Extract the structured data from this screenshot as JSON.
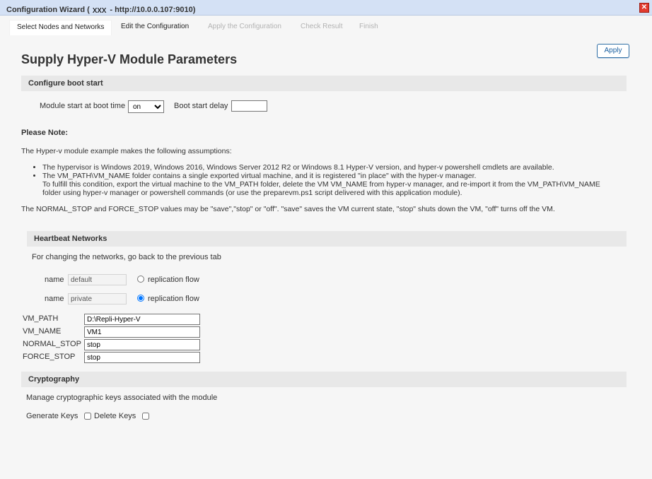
{
  "window": {
    "title_prefix": "Configuration Wizard (",
    "host": "xxx",
    "title_suffix": "- http://10.0.0.107:9010)",
    "close_glyph": "✕"
  },
  "tabs": [
    {
      "label": "Select Nodes and Networks",
      "state": "active"
    },
    {
      "label": "Edit the Configuration",
      "state": "normal"
    },
    {
      "label": "Apply the Configuration",
      "state": "disabled"
    },
    {
      "label": "Check Result",
      "state": "disabled"
    },
    {
      "label": "Finish",
      "state": "disabled"
    }
  ],
  "apply_label": "Apply",
  "page_title": "Supply Hyper-V Module Parameters",
  "boot": {
    "header": "Configure boot start",
    "start_label": "Module start at boot time",
    "start_value": "on",
    "delay_label": "Boot start delay",
    "delay_value": ""
  },
  "note": {
    "heading": "Please Note:",
    "intro": "The Hyper-v module example makes the following assumptions:",
    "bullet1": "The hypervisor is Windows 2019, Windows 2016, Windows Server 2012 R2 or Windows 8.1 Hyper-V version, and hyper-v powershell cmdlets are available.",
    "bullet2_line1": "The VM_PATH\\VM_NAME folder contains a single exported virtual machine, and it is registered \"in place\" with the hyper-v manager.",
    "bullet2_line2": "To fulfill this condition, export the virtual machine to the VM_PATH folder, delete the VM VM_NAME from hyper-v manager, and re-import it from the VM_PATH\\VM_NAME",
    "bullet2_line3": "folder using hyper-v manager or powershell commands (or use the preparevm.ps1 script delivered with this application module).",
    "stop_values": "The NORMAL_STOP and FORCE_STOP values may be \"save\",\"stop\" or \"off\". \"save\" saves the VM current state, \"stop\" shuts down the VM, \"off\" turns off the VM."
  },
  "heartbeat": {
    "header": "Heartbeat Networks",
    "info": "For changing the networks, go back to the previous tab",
    "name_label": "name",
    "networks": [
      {
        "name": "default",
        "flow_label": "replication flow",
        "selected": false
      },
      {
        "name": "private",
        "flow_label": "replication flow",
        "selected": true
      }
    ]
  },
  "params": [
    {
      "label": "VM_PATH",
      "value": "D:\\Repli-Hyper-V"
    },
    {
      "label": "VM_NAME",
      "value": "VM1"
    },
    {
      "label": "NORMAL_STOP",
      "value": "stop"
    },
    {
      "label": "FORCE_STOP",
      "value": "stop"
    }
  ],
  "crypto": {
    "header": "Cryptography",
    "info": "Manage cryptographic keys associated with the module",
    "generate_label": "Generate Keys",
    "delete_label": "Delete Keys"
  }
}
